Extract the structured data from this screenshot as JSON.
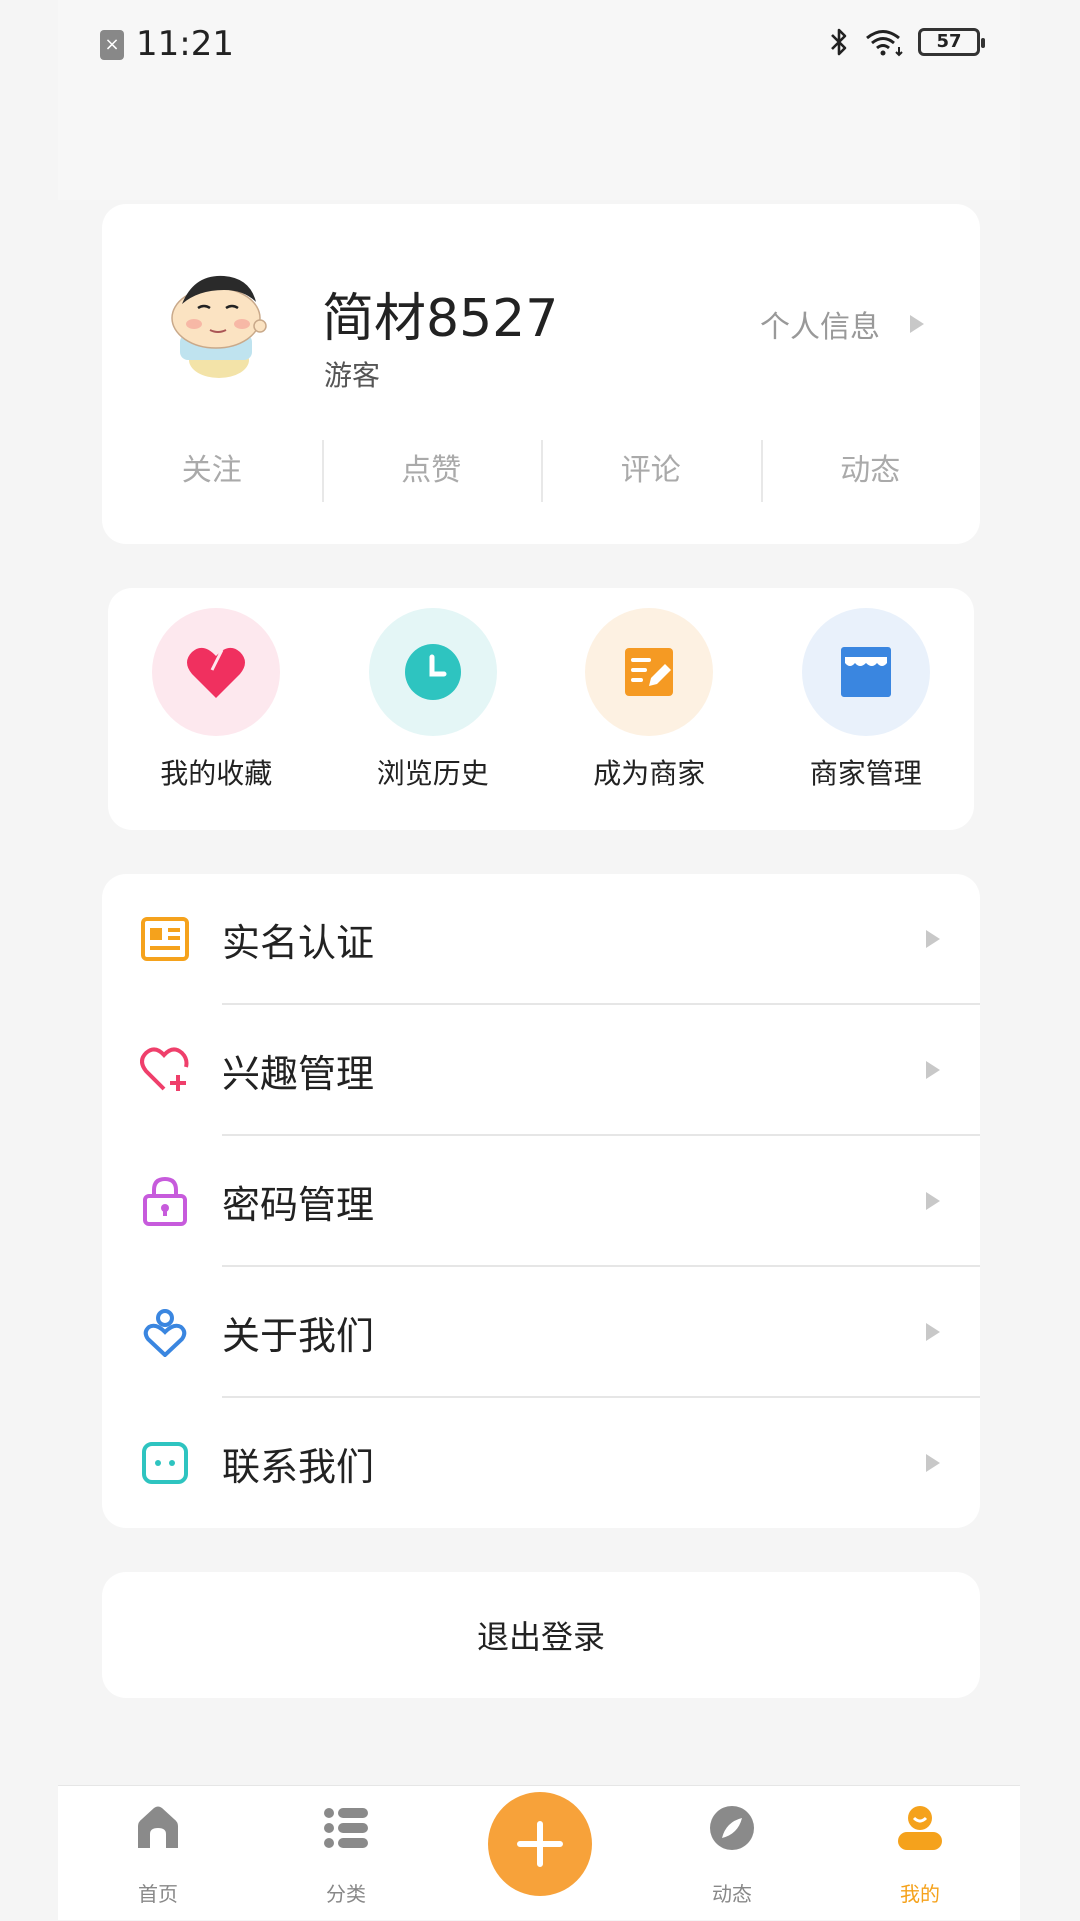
{
  "status_bar": {
    "time": "11:21",
    "battery": "57",
    "icons": [
      "sim-icon",
      "bluetooth-icon",
      "wifi-icon",
      "battery-icon"
    ]
  },
  "profile": {
    "name": "简材8527",
    "role": "游客",
    "info_link": "个人信息",
    "stats": [
      "关注",
      "点赞",
      "评论",
      "动态"
    ]
  },
  "quick_actions": [
    {
      "label": "我的收藏",
      "icon": "heart-icon",
      "bg": "#fde8ee",
      "color": "#f0305f"
    },
    {
      "label": "浏览历史",
      "icon": "clock-icon",
      "bg": "#e4f6f6",
      "color": "#2ec4c0"
    },
    {
      "label": "成为商家",
      "icon": "edit-note-icon",
      "bg": "#fdf1e2",
      "color": "#f59a23"
    },
    {
      "label": "商家管理",
      "icon": "store-icon",
      "bg": "#e9f1fb",
      "color": "#3a86e0"
    }
  ],
  "menu": [
    {
      "label": "实名认证",
      "icon": "id-card-icon",
      "color": "#f5a21c"
    },
    {
      "label": "兴趣管理",
      "icon": "heart-plus-icon",
      "color": "#ef3f6b"
    },
    {
      "label": "密码管理",
      "icon": "lock-icon",
      "color": "#c75bdc"
    },
    {
      "label": "关于我们",
      "icon": "about-icon",
      "color": "#3a86e0"
    },
    {
      "label": "联系我们",
      "icon": "chat-icon",
      "color": "#2ec4c0"
    }
  ],
  "logout": "退出登录",
  "tabbar": {
    "tabs": [
      {
        "label": "首页",
        "icon": "home-icon"
      },
      {
        "label": "分类",
        "icon": "list-icon"
      },
      {
        "label": "动态",
        "icon": "compass-icon"
      },
      {
        "label": "我的",
        "icon": "user-icon"
      }
    ],
    "active_color": "#f5a21c",
    "add_icon": "plus-icon"
  }
}
